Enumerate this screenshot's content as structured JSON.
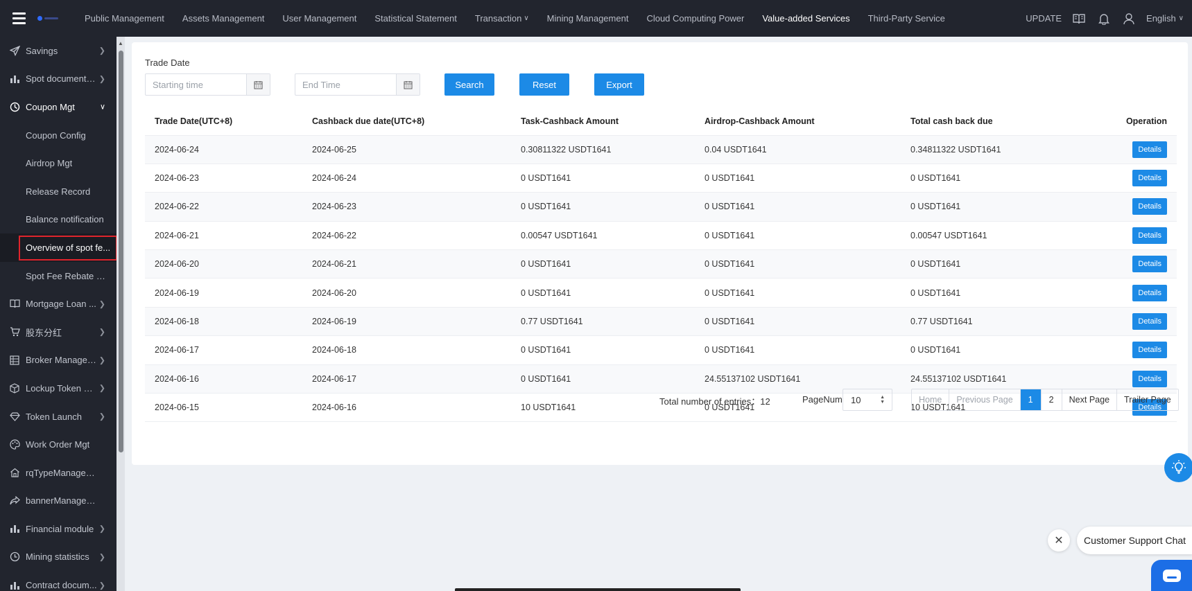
{
  "topnav": {
    "items": [
      {
        "label": "Public Management"
      },
      {
        "label": "Assets Management"
      },
      {
        "label": "User Management"
      },
      {
        "label": "Statistical Statement"
      },
      {
        "label": "Transaction"
      },
      {
        "label": "Mining Management"
      },
      {
        "label": "Cloud Computing Power"
      },
      {
        "label": "Value-added Services"
      },
      {
        "label": "Third-Party Service"
      }
    ],
    "active": "Value-added Services",
    "update_label": "UPDATE",
    "language": "English"
  },
  "sidebar": {
    "items": [
      {
        "label": "Savings",
        "icon": "send-icon"
      },
      {
        "label": "Spot documenta...",
        "icon": "bar-chart-icon"
      },
      {
        "label": "Coupon Mgt",
        "icon": "coupon-icon"
      },
      {
        "label": "Coupon Config"
      },
      {
        "label": "Airdrop Mgt"
      },
      {
        "label": "Release Record"
      },
      {
        "label": "Balance notification"
      },
      {
        "label": "Overview of spot fe..."
      },
      {
        "label": "Spot Fee Rebate De..."
      },
      {
        "label": "Mortgage Loan ...",
        "icon": "book-icon"
      },
      {
        "label": "股东分红",
        "icon": "cart-icon"
      },
      {
        "label": "Broker Managem...",
        "icon": "grid-icon"
      },
      {
        "label": "Lockup Token Mgt",
        "icon": "box-icon"
      },
      {
        "label": "Token Launch",
        "icon": "diamond-icon"
      },
      {
        "label": "Work Order Mgt",
        "icon": "palette-icon"
      },
      {
        "label": "rqTypeManagement",
        "icon": "home-icon"
      },
      {
        "label": "bannerManagerment",
        "icon": "share-icon"
      },
      {
        "label": "Financial module",
        "icon": "bar-chart-icon"
      },
      {
        "label": "Mining statistics",
        "icon": "clock-icon"
      },
      {
        "label": "Contract docum...",
        "icon": "bar-chart-icon"
      }
    ]
  },
  "filter": {
    "label": "Trade Date",
    "start_placeholder": "Starting time",
    "end_placeholder": "End Time",
    "search_label": "Search",
    "reset_label": "Reset",
    "export_label": "Export"
  },
  "table": {
    "headers": [
      "Trade Date(UTC+8)",
      "Cashback due date(UTC+8)",
      "Task-Cashback Amount",
      "Airdrop-Cashback Amount",
      "Total cash back due",
      "Operation"
    ],
    "details_label": "Details",
    "rows": [
      [
        "2024-06-24",
        "2024-06-25",
        "0.30811322 USDT1641",
        "0.04 USDT1641",
        "0.34811322 USDT1641"
      ],
      [
        "2024-06-23",
        "2024-06-24",
        "0 USDT1641",
        "0 USDT1641",
        "0 USDT1641"
      ],
      [
        "2024-06-22",
        "2024-06-23",
        "0 USDT1641",
        "0 USDT1641",
        "0 USDT1641"
      ],
      [
        "2024-06-21",
        "2024-06-22",
        "0.00547 USDT1641",
        "0 USDT1641",
        "0.00547 USDT1641"
      ],
      [
        "2024-06-20",
        "2024-06-21",
        "0 USDT1641",
        "0 USDT1641",
        "0 USDT1641"
      ],
      [
        "2024-06-19",
        "2024-06-20",
        "0 USDT1641",
        "0 USDT1641",
        "0 USDT1641"
      ],
      [
        "2024-06-18",
        "2024-06-19",
        "0.77 USDT1641",
        "0 USDT1641",
        "0.77 USDT1641"
      ],
      [
        "2024-06-17",
        "2024-06-18",
        "0 USDT1641",
        "0 USDT1641",
        "0 USDT1641"
      ],
      [
        "2024-06-16",
        "2024-06-17",
        "0 USDT1641",
        "24.55137102 USDT1641",
        "24.55137102 USDT1641"
      ],
      [
        "2024-06-15",
        "2024-06-16",
        "10 USDT1641",
        "0 USDT1641",
        "10 USDT1641"
      ]
    ]
  },
  "pagination": {
    "total_label": "Total number of entries：",
    "total": "12",
    "pagenum_label": "PageNum",
    "page_size": "10",
    "home": "Home",
    "previous": "Previous Page",
    "pages": [
      "1",
      "2"
    ],
    "current": "1",
    "next": "Next Page",
    "trailer": "Trailer Page"
  },
  "chat": {
    "label": "Customer Support Chat"
  },
  "colors": {
    "topbar": "#22252e",
    "accent": "#1c8ae6",
    "highlight_border": "#e0242c"
  }
}
